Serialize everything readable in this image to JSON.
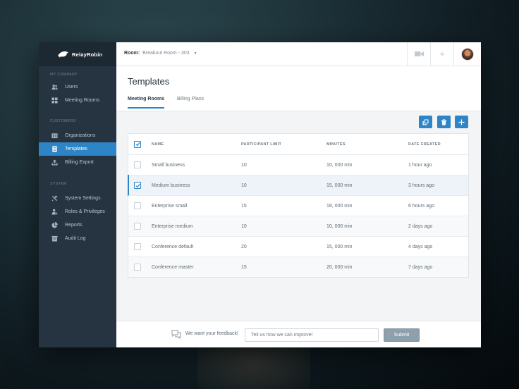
{
  "brand": {
    "name": "RelayRobin"
  },
  "sidebar": {
    "sections": [
      {
        "title": "My Company",
        "items": [
          {
            "label": "Users",
            "icon": "users-icon",
            "active": false
          },
          {
            "label": "Meeting Rooms",
            "icon": "grid-icon",
            "active": false
          }
        ]
      },
      {
        "title": "Customers",
        "items": [
          {
            "label": "Organizations",
            "icon": "building-icon",
            "active": false
          },
          {
            "label": "Templates",
            "icon": "document-icon",
            "active": true
          },
          {
            "label": "Billing Export",
            "icon": "export-icon",
            "active": false
          }
        ]
      },
      {
        "title": "System",
        "items": [
          {
            "label": "System Settings",
            "icon": "tools-icon",
            "active": false
          },
          {
            "label": "Roles & Privileges",
            "icon": "user-key-icon",
            "active": false
          },
          {
            "label": "Reports",
            "icon": "pie-chart-icon",
            "active": false
          },
          {
            "label": "Audit Log",
            "icon": "archive-icon",
            "active": false
          }
        ]
      }
    ]
  },
  "topbar": {
    "room_label": "Room:",
    "room_name": "Breakout Room - 303",
    "caret": "▼",
    "plus": "+"
  },
  "main": {
    "title": "Templates",
    "tabs": [
      {
        "label": "Meeting Rooms",
        "active": true
      },
      {
        "label": "Billing Plans",
        "active": false
      }
    ]
  },
  "table": {
    "columns": [
      "Name",
      "Participant Limit",
      "Minutes",
      "Date Created"
    ],
    "rows": [
      {
        "name": "Small business",
        "limit": "10",
        "minutes": "10, 000 min",
        "date": "1 hour ago",
        "checked": false
      },
      {
        "name": "Medium business",
        "limit": "10",
        "minutes": "15, 000 min",
        "date": "3 hours ago",
        "checked": true
      },
      {
        "name": "Enterprise small",
        "limit": "15",
        "minutes": "18, 000 min",
        "date": "6 hours ago",
        "checked": false
      },
      {
        "name": "Enterprise medium",
        "limit": "10",
        "minutes": "10, 000 min",
        "date": "2 days ago",
        "checked": false
      },
      {
        "name": "Conference default",
        "limit": "20",
        "minutes": "15, 000 min",
        "date": "4 days ago",
        "checked": false
      },
      {
        "name": "Conference master",
        "limit": "15",
        "minutes": "20, 000 min",
        "date": "7 days ago",
        "checked": false
      }
    ]
  },
  "feedback": {
    "text": "We want your feedback!",
    "placeholder": "Tell us how we can improve!",
    "submit": "Submit"
  },
  "colors": {
    "accent": "#2d84c6",
    "sidebar": "#253440",
    "brand_bar": "#1c2832"
  }
}
